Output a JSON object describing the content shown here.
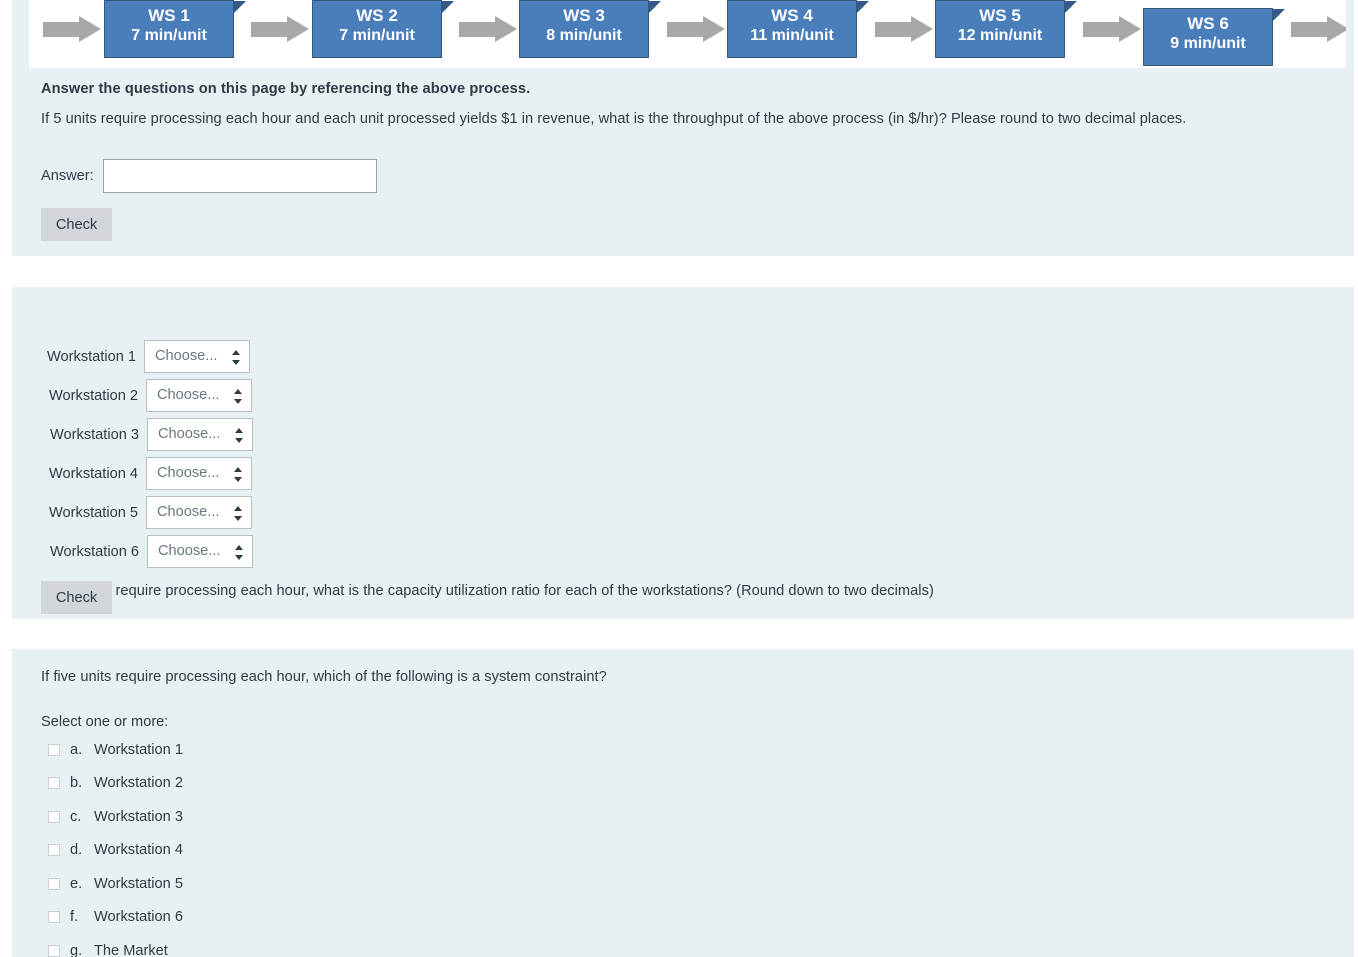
{
  "diagram": {
    "name": "process-flow-diagram",
    "box_color": "#4a7ebb",
    "arrow_color": "#a8a8a8",
    "workstations": [
      {
        "title": "WS 1",
        "rate": "7 min/unit"
      },
      {
        "title": "WS 2",
        "rate": "7 min/unit"
      },
      {
        "title": "WS 3",
        "rate": "8 min/unit"
      },
      {
        "title": "WS 4",
        "rate": "11 min/unit"
      },
      {
        "title": "WS 5",
        "rate": "12 min/unit"
      },
      {
        "title": "WS 6",
        "rate": "9 min/unit"
      }
    ]
  },
  "question1": {
    "instruction": "Answer the questions on this page by referencing the above process.",
    "text": "If 5 units require processing each hour and each unit processed yields $1 in revenue, what is the throughput of the above process (in $/hr)?  Please round to two decimal places.",
    "answer_label": "Answer:",
    "answer_value": "",
    "answer_placeholder": "",
    "check_label": "Check"
  },
  "question2": {
    "text": "If five units require processing each hour, what is the capacity utilization ratio for each of the workstations? (Round down to two decimals)",
    "rows": [
      {
        "label": "Workstation 1",
        "selected": "Choose..."
      },
      {
        "label": "Workstation 2",
        "selected": "Choose..."
      },
      {
        "label": "Workstation 3",
        "selected": "Choose..."
      },
      {
        "label": "Workstation 4",
        "selected": "Choose..."
      },
      {
        "label": "Workstation 5",
        "selected": "Choose..."
      },
      {
        "label": "Workstation 6",
        "selected": "Choose..."
      }
    ],
    "check_label": "Check"
  },
  "question3": {
    "text": "If five units require processing each hour, which of the following is a system constraint?",
    "select_prompt": "Select one or more:",
    "options": [
      {
        "letter": "a.",
        "label": "Workstation 1",
        "checked": false
      },
      {
        "letter": "b.",
        "label": "Workstation 2",
        "checked": false
      },
      {
        "letter": "c.",
        "label": "Workstation 3",
        "checked": false
      },
      {
        "letter": "d.",
        "label": "Workstation 4",
        "checked": false
      },
      {
        "letter": "e.",
        "label": "Workstation 5",
        "checked": false
      },
      {
        "letter": "f.",
        "label": "Workstation 6",
        "checked": false
      },
      {
        "letter": "g.",
        "label": "The Market",
        "checked": false
      }
    ]
  }
}
